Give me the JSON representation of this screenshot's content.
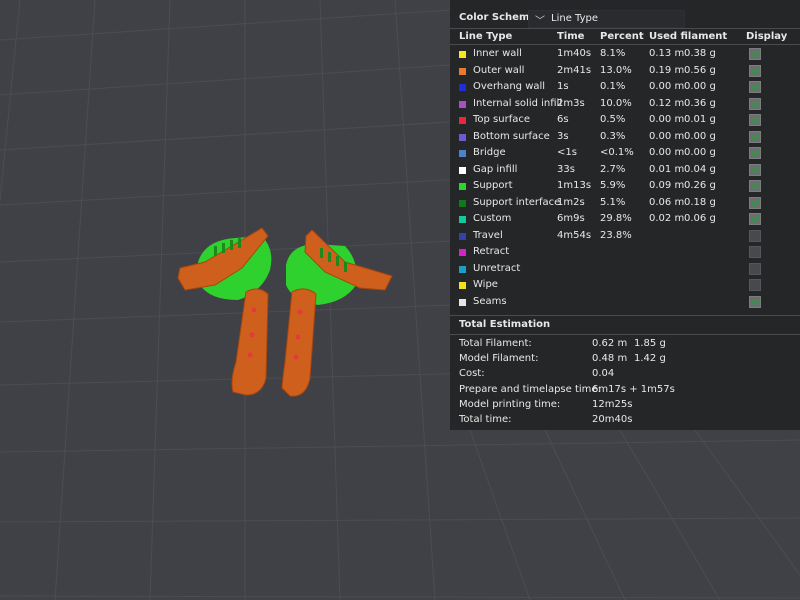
{
  "panel": {
    "color_scheme_label": "Color Scheme",
    "color_scheme_value": "Line Type",
    "columns": {
      "line_type": "Line Type",
      "time": "Time",
      "percent": "Percent",
      "used_filament": "Used filament",
      "display": "Display"
    },
    "rows": [
      {
        "name": "Inner wall",
        "color": "#f7e61a",
        "time": "1m40s",
        "percent": "8.1%",
        "length": "0.13 m",
        "weight": "0.38 g",
        "display": true
      },
      {
        "name": "Outer wall",
        "color": "#e8792d",
        "time": "2m41s",
        "percent": "13.0%",
        "length": "0.19 m",
        "weight": "0.56 g",
        "display": true
      },
      {
        "name": "Overhang wall",
        "color": "#1f2ed6",
        "time": "1s",
        "percent": "0.1%",
        "length": "0.00 m",
        "weight": "0.00 g",
        "display": true
      },
      {
        "name": "Internal solid infill",
        "color": "#a94fc2",
        "time": "2m3s",
        "percent": "10.0%",
        "length": "0.12 m",
        "weight": "0.36 g",
        "display": true
      },
      {
        "name": "Top surface",
        "color": "#e8283a",
        "time": "6s",
        "percent": "0.5%",
        "length": "0.00 m",
        "weight": "0.01 g",
        "display": true
      },
      {
        "name": "Bottom surface",
        "color": "#6d5ad3",
        "time": "3s",
        "percent": "0.3%",
        "length": "0.00 m",
        "weight": "0.00 g",
        "display": true
      },
      {
        "name": "Bridge",
        "color": "#4a83c7",
        "time": "<1s",
        "percent": "<0.1%",
        "length": "0.00 m",
        "weight": "0.00 g",
        "display": true
      },
      {
        "name": "Gap infill",
        "color": "#ffffff",
        "time": "33s",
        "percent": "2.7%",
        "length": "0.01 m",
        "weight": "0.04 g",
        "display": true
      },
      {
        "name": "Support",
        "color": "#2bd62b",
        "time": "1m13s",
        "percent": "5.9%",
        "length": "0.09 m",
        "weight": "0.26 g",
        "display": true
      },
      {
        "name": "Support interface",
        "color": "#0f7a1a",
        "time": "1m2s",
        "percent": "5.1%",
        "length": "0.06 m",
        "weight": "0.18 g",
        "display": true
      },
      {
        "name": "Custom",
        "color": "#11c99a",
        "time": "6m9s",
        "percent": "29.8%",
        "length": "0.02 m",
        "weight": "0.06 g",
        "display": true
      },
      {
        "name": "Travel",
        "color": "#3541a8",
        "time": "4m54s",
        "percent": "23.8%",
        "length": "",
        "weight": "",
        "display": false
      },
      {
        "name": "Retract",
        "color": "#d424c8",
        "time": "",
        "percent": "",
        "length": "",
        "weight": "",
        "display": false
      },
      {
        "name": "Unretract",
        "color": "#1aa0c7",
        "time": "",
        "percent": "",
        "length": "",
        "weight": "",
        "display": false
      },
      {
        "name": "Wipe",
        "color": "#f2e21c",
        "time": "",
        "percent": "",
        "length": "",
        "weight": "",
        "display": false
      },
      {
        "name": "Seams",
        "color": "#e6e6e6",
        "time": "",
        "percent": "",
        "length": "",
        "weight": "",
        "display": true
      }
    ],
    "total_estimation": {
      "title": "Total Estimation",
      "items": [
        {
          "label": "Total Filament:",
          "v1": "0.62 m",
          "v2": "1.85 g"
        },
        {
          "label": "Model Filament:",
          "v1": "0.48 m",
          "v2": "1.42 g"
        },
        {
          "label": "Cost:",
          "v1": "0.04",
          "v2": ""
        },
        {
          "label": "Prepare and timelapse time:",
          "v1": "6m17s + 1m57s",
          "v2": ""
        },
        {
          "label": "Model printing time:",
          "v1": "12m25s",
          "v2": ""
        },
        {
          "label": "Total time:",
          "v1": "20m40s",
          "v2": ""
        }
      ]
    }
  }
}
